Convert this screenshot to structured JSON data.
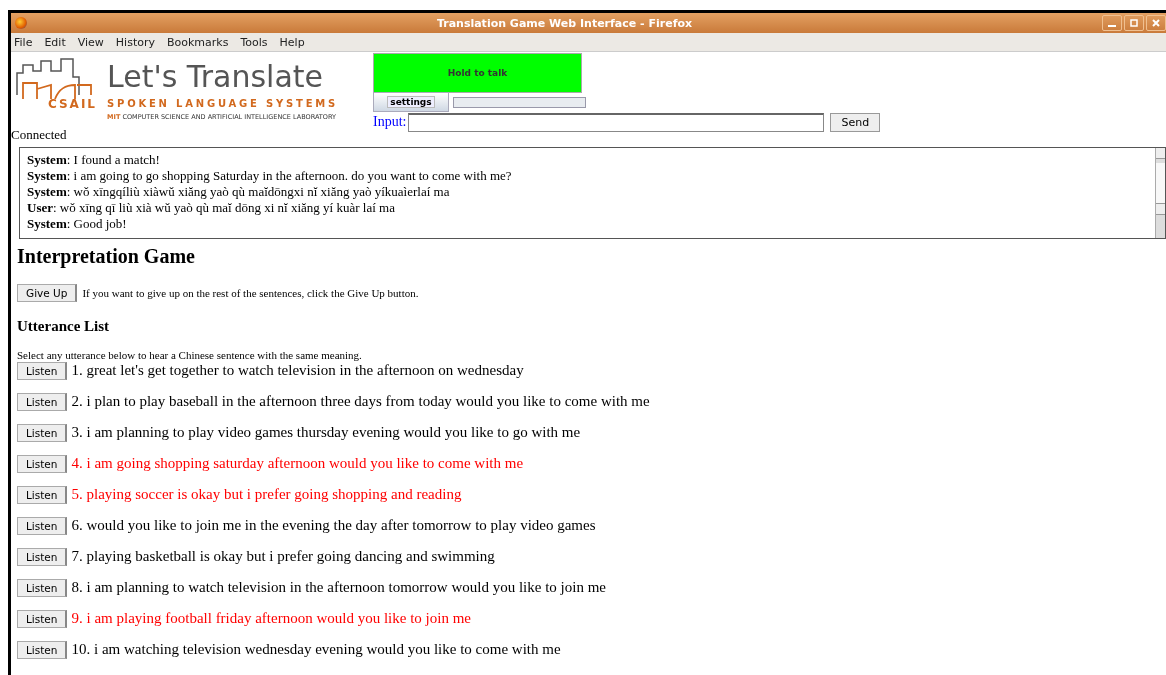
{
  "window": {
    "title": "Translation Game Web Interface - Firefox"
  },
  "menu": [
    "File",
    "Edit",
    "View",
    "History",
    "Bookmarks",
    "Tools",
    "Help"
  ],
  "logo": {
    "title": "Let's Translate",
    "subtitle": "SPOKEN LANGUAGE SYSTEMS",
    "mark": "CSAIL",
    "lab_prefix": "MIT",
    "lab": "COMPUTER SCIENCE AND ARTIFICIAL INTELLIGENCE LABORATORY"
  },
  "talk_button": "Hold to talk",
  "settings_button": "settings",
  "input": {
    "label": "Input:"
  },
  "send_button": "Send",
  "status": "Connected",
  "chat": [
    "**System**: I found a match!",
    "**System**: i am going to go shopping Saturday in the afternoon. do you want to come with me?",
    "**System**: wǒ xīngqíliù xiàwǔ xiăng yaò qù maĭdōngxi nĭ xiăng yaò yíkuaìerlaí ma",
    "**User**: wǒ xīng qī liù xià wǔ yaò qù maĭ dōng xi nĭ xiăng yí kuàr laí ma",
    "**System**: Good job!"
  ],
  "heading": "Interpretation Game",
  "give_up_button": "Give Up",
  "give_up_hint": "If you want to give up on the rest of the sentences, click the Give Up button.",
  "list_heading": "Utterance List",
  "list_hint": "Select any utterance below to hear a Chinese sentence with the same meaning.",
  "utterances": [
    {
      "listen": "Listen",
      "text": "1. great let's get together to watch television in the afternoon on wednesday",
      "color": "#000000"
    },
    {
      "listen": "Listen",
      "text": "2. i plan to play baseball in the afternoon three days from today would you like to come with me",
      "color": "#000000"
    },
    {
      "listen": "Listen",
      "text": "3. i am planning to play video games thursday evening would you like to go with me",
      "color": "#000000"
    },
    {
      "listen": "Listen",
      "text": "4. i am going shopping saturday afternoon would you like to come with me",
      "color": "#ff0000"
    },
    {
      "listen": "Listen",
      "text": "5. playing soccer is okay but i prefer going shopping and reading",
      "color": "#ff0000"
    },
    {
      "listen": "Listen",
      "text": "6. would you like to join me in the evening the day after tomorrow to play video games",
      "color": "#000000"
    },
    {
      "listen": "Listen",
      "text": "7. playing basketball is okay but i prefer going dancing and swimming",
      "color": "#000000"
    },
    {
      "listen": "Listen",
      "text": "8. i am planning to watch television in the afternoon tomorrow would you like to join me",
      "color": "#000000"
    },
    {
      "listen": "Listen",
      "text": "9. i am playing football friday afternoon would you like to join me",
      "color": "#ff0000"
    },
    {
      "listen": "Listen",
      "text": "10. i am watching television wednesday evening would you like to come with me",
      "color": "#000000"
    }
  ]
}
